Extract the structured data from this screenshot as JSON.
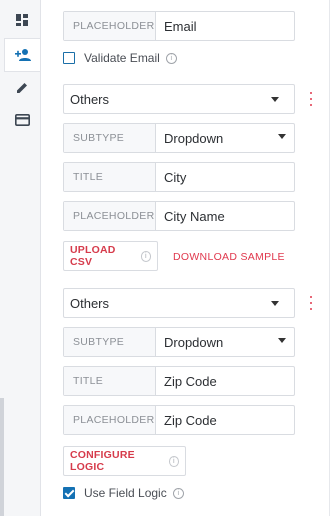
{
  "rail": {
    "icons": [
      "dashboard-icon",
      "add-person-icon",
      "pencil-icon",
      "card-icon"
    ]
  },
  "email_block": {
    "placeholder_label": "PLACEHOLDER",
    "placeholder_value": "Email",
    "validate_label": "Validate Email",
    "validate_checked": false
  },
  "city_block": {
    "type_value": "Others",
    "subtype_label": "SUBTYPE",
    "subtype_value": "Dropdown",
    "title_label": "TITLE",
    "title_value": "City",
    "placeholder_label": "PLACEHOLDER",
    "placeholder_value": "City Name",
    "upload_label": "UPLOAD CSV",
    "download_label": "DOWNLOAD SAMPLE"
  },
  "zip_block": {
    "type_value": "Others",
    "subtype_label": "SUBTYPE",
    "subtype_value": "Dropdown",
    "title_label": "TITLE",
    "title_value": "Zip Code",
    "placeholder_label": "PLACEHOLDER",
    "placeholder_value": "Zip Code",
    "configure_label": "CONFIGURE LOGIC",
    "field_logic_label": "Use Field Logic",
    "field_logic_checked": true
  },
  "colors": {
    "accent_red": "#e0384d",
    "accent_blue": "#1471b3"
  }
}
